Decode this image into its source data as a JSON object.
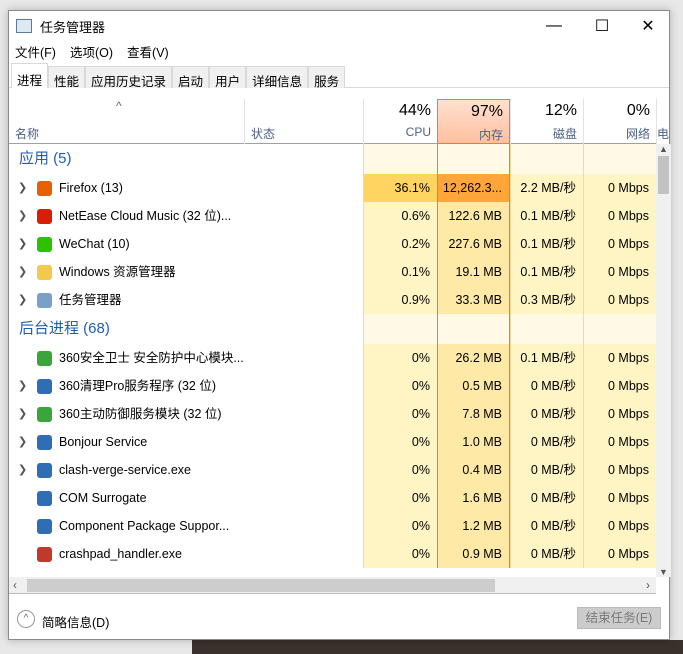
{
  "window": {
    "title": "任务管理器"
  },
  "menu": [
    "文件(F)",
    "选项(O)",
    "查看(V)"
  ],
  "tabs": [
    "进程",
    "性能",
    "应用历史记录",
    "启动",
    "用户",
    "详细信息",
    "服务"
  ],
  "header": {
    "name": "名称",
    "status": "状态",
    "cpu_pct": "44%",
    "cpu": "CPU",
    "mem_pct": "97%",
    "mem": "内存",
    "disk_pct": "12%",
    "disk": "磁盘",
    "net_pct": "0%",
    "net": "网络",
    "extra": "电"
  },
  "groups": [
    {
      "title": "应用 (5)",
      "rows": [
        {
          "name": "Firefox (13)",
          "cpu": "36.1%",
          "mem": "12,262.3...",
          "disk": "2.2 MB/秒",
          "net": "0 Mbps",
          "icon": "firefox-icon",
          "expand": true,
          "color": "#e66000"
        },
        {
          "name": "NetEase Cloud Music (32 位)...",
          "cpu": "0.6%",
          "mem": "122.6 MB",
          "disk": "0.1 MB/秒",
          "net": "0 Mbps",
          "icon": "netease-music-icon",
          "expand": true,
          "color": "#d81e06"
        },
        {
          "name": "WeChat (10)",
          "cpu": "0.2%",
          "mem": "227.6 MB",
          "disk": "0.1 MB/秒",
          "net": "0 Mbps",
          "icon": "wechat-icon",
          "expand": true,
          "color": "#2dc100"
        },
        {
          "name": "Windows 资源管理器",
          "cpu": "0.1%",
          "mem": "19.1 MB",
          "disk": "0.1 MB/秒",
          "net": "0 Mbps",
          "icon": "folder-icon",
          "expand": true,
          "color": "#f2c94c"
        },
        {
          "name": "任务管理器",
          "cpu": "0.9%",
          "mem": "33.3 MB",
          "disk": "0.3 MB/秒",
          "net": "0 Mbps",
          "icon": "task-manager-icon",
          "expand": true,
          "color": "#7aa0c8"
        }
      ]
    },
    {
      "title": "后台进程 (68)",
      "rows": [
        {
          "name": "360安全卫士 安全防护中心模块...",
          "cpu": "0%",
          "mem": "26.2 MB",
          "disk": "0.1 MB/秒",
          "net": "0 Mbps",
          "icon": "360-icon",
          "expand": false,
          "color": "#3aa53a"
        },
        {
          "name": "360清理Pro服务程序 (32 位)",
          "cpu": "0%",
          "mem": "0.5 MB",
          "disk": "0 MB/秒",
          "net": "0 Mbps",
          "icon": "service-icon",
          "expand": true,
          "color": "#2f6db5"
        },
        {
          "name": "360主动防御服务模块 (32 位)",
          "cpu": "0%",
          "mem": "7.8 MB",
          "disk": "0 MB/秒",
          "net": "0 Mbps",
          "icon": "360-icon",
          "expand": true,
          "color": "#3aa53a"
        },
        {
          "name": "Bonjour Service",
          "cpu": "0%",
          "mem": "1.0 MB",
          "disk": "0 MB/秒",
          "net": "0 Mbps",
          "icon": "service-icon",
          "expand": true,
          "color": "#2f6db5"
        },
        {
          "name": "clash-verge-service.exe",
          "cpu": "0%",
          "mem": "0.4 MB",
          "disk": "0 MB/秒",
          "net": "0 Mbps",
          "icon": "service-icon",
          "expand": true,
          "color": "#2f6db5"
        },
        {
          "name": "COM Surrogate",
          "cpu": "0%",
          "mem": "1.6 MB",
          "disk": "0 MB/秒",
          "net": "0 Mbps",
          "icon": "service-icon",
          "expand": false,
          "color": "#2f6db5"
        },
        {
          "name": "Component Package Suppor...",
          "cpu": "0%",
          "mem": "1.2 MB",
          "disk": "0 MB/秒",
          "net": "0 Mbps",
          "icon": "service-icon",
          "expand": false,
          "color": "#2f6db5"
        },
        {
          "name": "crashpad_handler.exe",
          "cpu": "0%",
          "mem": "0.9 MB",
          "disk": "0 MB/秒",
          "net": "0 Mbps",
          "icon": "crashpad-icon",
          "expand": false,
          "color": "#c0392b"
        }
      ]
    }
  ],
  "footer": {
    "fewer_details": "简略信息(D)",
    "end_task": "结束任务(E)"
  }
}
